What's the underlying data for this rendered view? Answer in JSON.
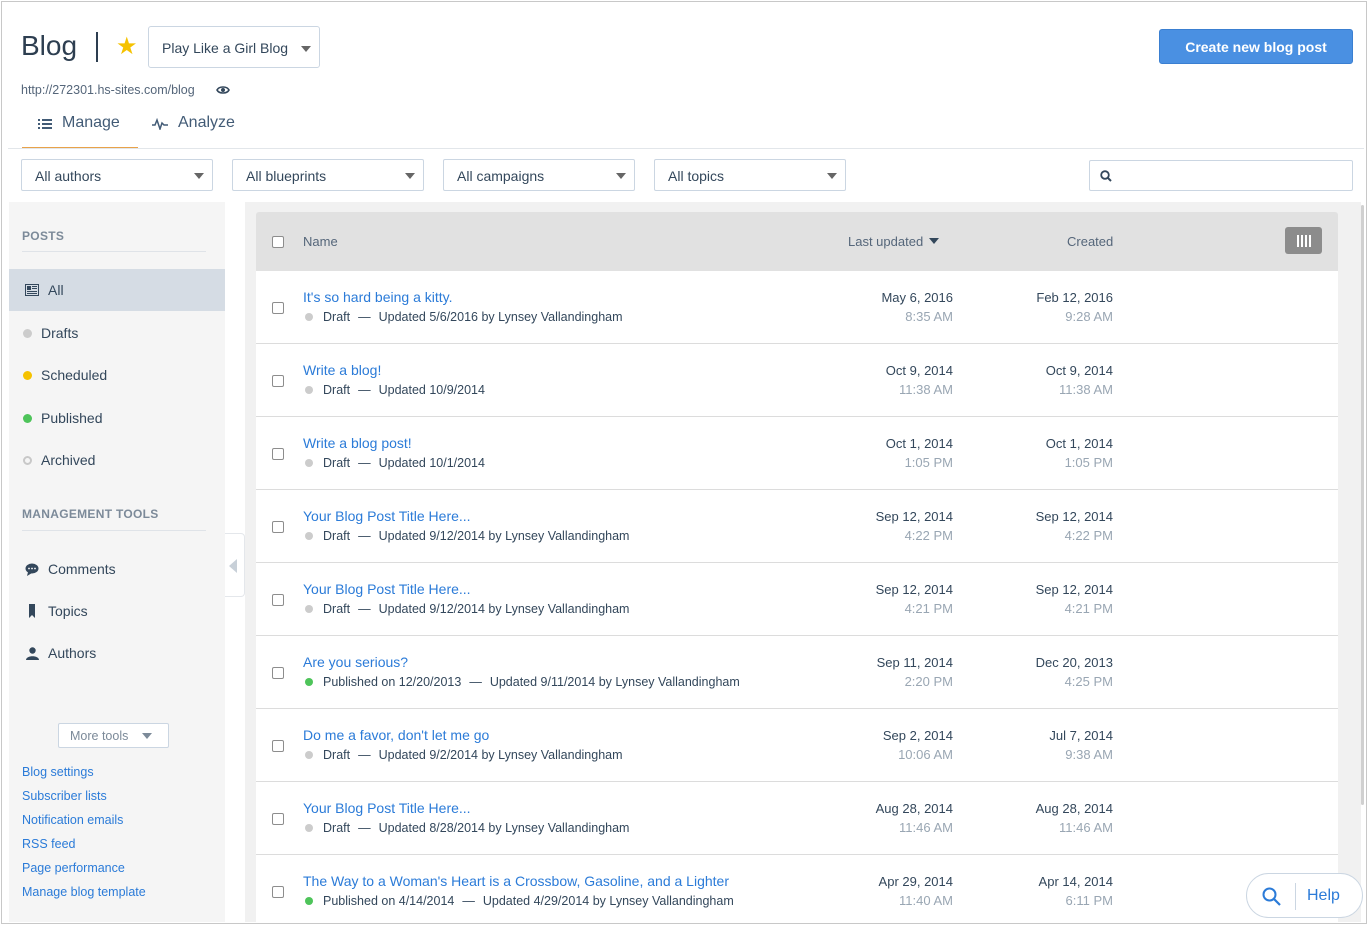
{
  "header": {
    "title": "Blog",
    "selected_blog": "Play Like a Girl Blog",
    "create_button": "Create new blog post",
    "blog_url": "http://272301.hs-sites.com/blog"
  },
  "tabs": [
    {
      "label": "Manage",
      "icon": "list-icon",
      "active": true
    },
    {
      "label": "Analyze",
      "icon": "analytics-icon",
      "active": false
    }
  ],
  "filters": [
    "All authors",
    "All blueprints",
    "All campaigns",
    "All topics"
  ],
  "search": {
    "placeholder": ""
  },
  "sidebar": {
    "posts_heading": "POSTS",
    "posts": [
      {
        "label": "All",
        "icon": "newspaper-icon",
        "active": true
      },
      {
        "label": "Drafts",
        "status_color": "#cccccc"
      },
      {
        "label": "Scheduled",
        "status_color": "#f5c200"
      },
      {
        "label": "Published",
        "status_color": "#4ec45a"
      },
      {
        "label": "Archived",
        "status_color": "ring"
      }
    ],
    "tools_heading": "MANAGEMENT TOOLS",
    "tools": [
      {
        "label": "Comments",
        "icon": "comment-icon"
      },
      {
        "label": "Topics",
        "icon": "bookmark-icon"
      },
      {
        "label": "Authors",
        "icon": "person-icon"
      }
    ],
    "more_tools": "More tools",
    "links": [
      "Blog settings",
      "Subscriber lists",
      "Notification emails",
      "RSS feed",
      "Page performance",
      "Manage blog template"
    ]
  },
  "table": {
    "columns": {
      "name": "Name",
      "last_updated": "Last updated",
      "created": "Created"
    },
    "rows": [
      {
        "title": "It's so hard being a kitty.",
        "status": "Draft",
        "status_color": "#cccccc",
        "published_on": "",
        "updated": "Updated 5/6/2016 by Lynsey Vallandingham",
        "updated_date": "May 6, 2016",
        "updated_time": "8:35 AM",
        "created_date": "Feb 12, 2016",
        "created_time": "9:28 AM"
      },
      {
        "title": "Write a blog!",
        "status": "Draft",
        "status_color": "#cccccc",
        "published_on": "",
        "updated": "Updated 10/9/2014",
        "updated_date": "Oct 9, 2014",
        "updated_time": "11:38 AM",
        "created_date": "Oct 9, 2014",
        "created_time": "11:38 AM"
      },
      {
        "title": "Write a blog post!",
        "status": "Draft",
        "status_color": "#cccccc",
        "published_on": "",
        "updated": "Updated 10/1/2014",
        "updated_date": "Oct 1, 2014",
        "updated_time": "1:05 PM",
        "created_date": "Oct 1, 2014",
        "created_time": "1:05 PM"
      },
      {
        "title": "Your Blog Post Title Here...",
        "status": "Draft",
        "status_color": "#cccccc",
        "published_on": "",
        "updated": "Updated 9/12/2014 by Lynsey Vallandingham",
        "updated_date": "Sep 12, 2014",
        "updated_time": "4:22 PM",
        "created_date": "Sep 12, 2014",
        "created_time": "4:22 PM"
      },
      {
        "title": "Your Blog Post Title Here...",
        "status": "Draft",
        "status_color": "#cccccc",
        "published_on": "",
        "updated": "Updated 9/12/2014 by Lynsey Vallandingham",
        "updated_date": "Sep 12, 2014",
        "updated_time": "4:21 PM",
        "created_date": "Sep 12, 2014",
        "created_time": "4:21 PM"
      },
      {
        "title": "Are you serious?",
        "status": "Published on 12/20/2013",
        "status_color": "#4ec45a",
        "published_on": "",
        "updated": "Updated 9/11/2014 by Lynsey Vallandingham",
        "updated_date": "Sep 11, 2014",
        "updated_time": "2:20 PM",
        "created_date": "Dec 20, 2013",
        "created_time": "4:25 PM"
      },
      {
        "title": "Do me a favor, don't let me go",
        "status": "Draft",
        "status_color": "#cccccc",
        "published_on": "",
        "updated": "Updated 9/2/2014 by Lynsey Vallandingham",
        "updated_date": "Sep 2, 2014",
        "updated_time": "10:06 AM",
        "created_date": "Jul 7, 2014",
        "created_time": "9:38 AM"
      },
      {
        "title": "Your Blog Post Title Here...",
        "status": "Draft",
        "status_color": "#cccccc",
        "published_on": "",
        "updated": "Updated 8/28/2014 by Lynsey Vallandingham",
        "updated_date": "Aug 28, 2014",
        "updated_time": "11:46 AM",
        "created_date": "Aug 28, 2014",
        "created_time": "11:46 AM"
      },
      {
        "title": "The Way to a Woman's Heart is a Crossbow, Gasoline, and a Lighter",
        "status": "Published on 4/14/2014",
        "status_color": "#4ec45a",
        "published_on": "",
        "updated": "Updated 4/29/2014 by Lynsey Vallandingham",
        "updated_date": "Apr 29, 2014",
        "updated_time": "11:40 AM",
        "created_date": "Apr 14, 2014",
        "created_time": "6:11 PM"
      }
    ]
  },
  "help": {
    "label": "Help"
  },
  "colors": {
    "accent": "#4a90e2",
    "link": "#2b7bd8",
    "tab_underline": "#e8a24a",
    "star": "#f5c200"
  }
}
